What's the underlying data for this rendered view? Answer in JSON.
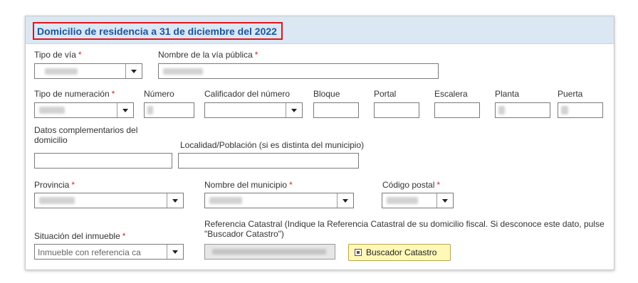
{
  "section": {
    "title": "Domicilio de residencia a 31 de diciembre del 2022"
  },
  "fields": {
    "tipo_via": {
      "label": "Tipo de vía",
      "required": "*"
    },
    "nombre_via": {
      "label": "Nombre de la vía pública",
      "required": "*"
    },
    "tipo_numeracion": {
      "label": "Tipo de numeración",
      "required": "*"
    },
    "numero": {
      "label": "Número"
    },
    "calificador": {
      "label": "Calificador del número"
    },
    "bloque": {
      "label": "Bloque"
    },
    "portal": {
      "label": "Portal"
    },
    "escalera": {
      "label": "Escalera"
    },
    "planta": {
      "label": "Planta"
    },
    "puerta": {
      "label": "Puerta"
    },
    "datos_complementarios": {
      "label": "Datos complementarios del domicilio"
    },
    "localidad": {
      "label": "Localidad/Población (si es distinta del municipio)"
    },
    "provincia": {
      "label": "Provincia",
      "required": "*"
    },
    "municipio": {
      "label": "Nombre del municipio",
      "required": "*"
    },
    "codigo_postal": {
      "label": "Código postal",
      "required": "*"
    },
    "situacion": {
      "label": "Situación del inmueble",
      "required": "*",
      "value": "Inmueble con referencia ca"
    },
    "referencia": {
      "label": "Referencia Catastral (Indique la Referencia Catastral de su domicilio fiscal. Si desconoce este dato, pulse \"Buscador Catastro\")"
    }
  },
  "buttons": {
    "buscador": "Buscador Catastro"
  },
  "colors": {
    "title": "#1a57a0",
    "highlight_border": "#e3141b",
    "required": "#d9222a",
    "header_bg": "#dbe7f2",
    "button_bg": "#fff8b8"
  }
}
